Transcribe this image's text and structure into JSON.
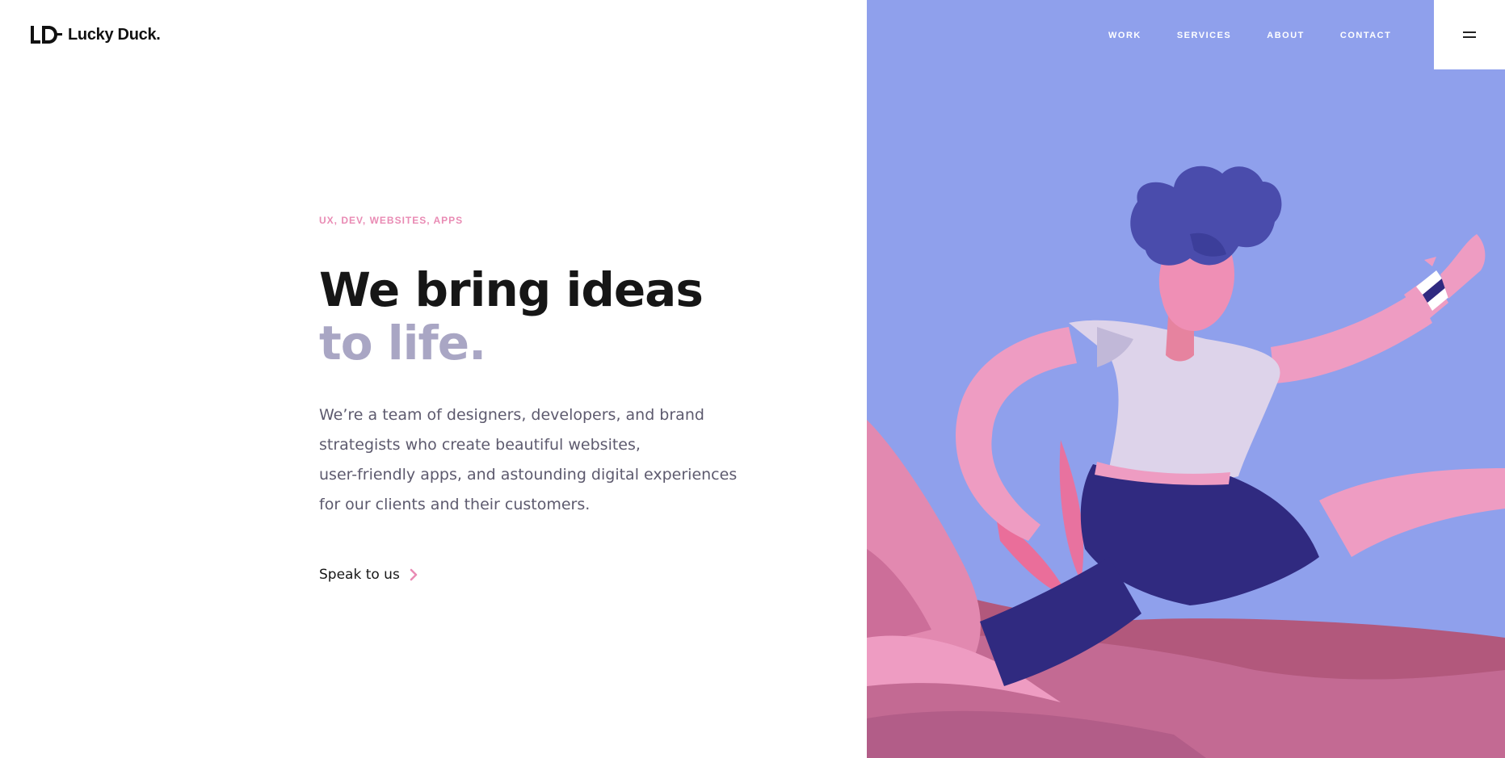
{
  "brand": {
    "name": "Lucky Duck."
  },
  "nav": {
    "items": [
      "WORK",
      "SERVICES",
      "ABOUT",
      "CONTACT"
    ]
  },
  "hero": {
    "eyebrow": "UX, DEV, WEBSITES, APPS",
    "headline_line1": "We bring ideas",
    "headline_line2": "to life.",
    "body_lines": [
      "We’re a team of designers, developers, and brand",
      "strategists who create beautiful websites,",
      "user-friendly apps, and astounding digital experiences",
      "for our clients and their customers."
    ],
    "cta_label": "Speak to us"
  },
  "colors": {
    "accent_pink": "#e98bb4",
    "muted_lavender": "#a9a6c4",
    "panel_blue": "#8fa0ec",
    "figure_navy": "#302a80"
  },
  "icons": {
    "logo": "ld-logo-icon",
    "cta": "chevron-right-icon",
    "menu": "hamburger-icon"
  }
}
